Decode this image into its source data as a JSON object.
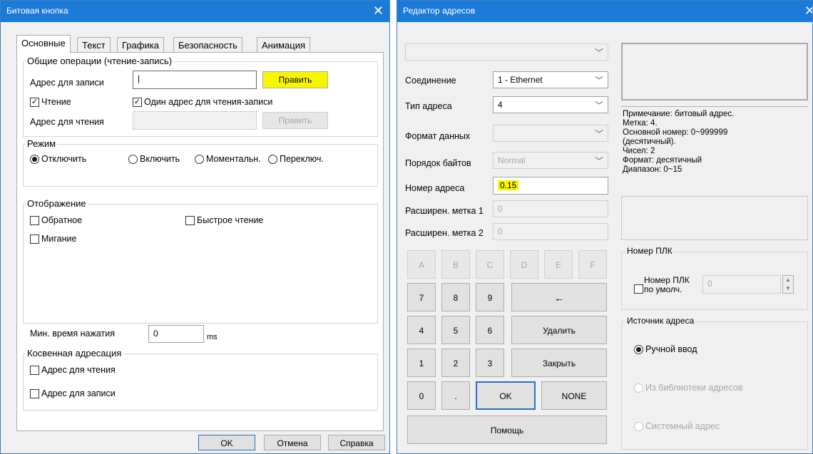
{
  "win1": {
    "title": "Битовая кнопка",
    "tabs": [
      "Основные",
      "Текст",
      "Графика",
      "Безопасность",
      "Анимация"
    ],
    "general_group": "Общие операции (чтение-запись)",
    "write_address_label": "Адрес для записи",
    "write_address_value": "|",
    "edit_button": "Править",
    "read_check_label": "Чтение",
    "single_address_label": "Один адрес для чтения-записи",
    "read_address_label": "Адрес для чтения",
    "read_address_value": "",
    "edit_button_disabled": "Править",
    "mode_group": "Режим",
    "mode_options": [
      "Отключить",
      "Включить",
      "Моментальн.",
      "Переключ."
    ],
    "display_group": "Отображение",
    "inverse_label": "Обратное",
    "fast_read_label": "Быстрое чтение",
    "blink_label": "Мигание",
    "min_press_label": "Мин. время нажатия",
    "min_press_value": "0",
    "min_press_unit": "ms",
    "indirect_group": "Косвенная адресация",
    "indirect_read_label": "Адрес для чтения",
    "indirect_write_label": "Адрес для записи",
    "ok": "OK",
    "cancel": "Отмена",
    "help": "Справка"
  },
  "win2": {
    "title": "Редактор адресов",
    "top_combo": "",
    "connection_label": "Соединение",
    "connection_value": "1 - Ethernet",
    "address_type_label": "Тип адреса",
    "address_type_value": "4",
    "data_format_label": "Формат данных",
    "data_format_value": "",
    "byte_order_label": "Порядок байтов",
    "byte_order_value": "Normal",
    "address_number_label": "Номер адреса",
    "address_number_value": "0.15",
    "ext_tag1_label": "Расширен. метка 1",
    "ext_tag1_value": "0",
    "ext_tag2_label": "Расширен. метка 2",
    "ext_tag2_value": "0",
    "hex_keys": [
      "A",
      "B",
      "C",
      "D",
      "E",
      "F"
    ],
    "digit_keys": {
      "k7": "7",
      "k8": "8",
      "k9": "9",
      "k4": "4",
      "k5": "5",
      "k6": "6",
      "k1": "1",
      "k2": "2",
      "k3": "3",
      "k0": "0",
      "kdot": "."
    },
    "backspace": "←",
    "delete": "Удалить",
    "close": "Закрыть",
    "ok": "OK",
    "none": "NONE",
    "help": "Помощь",
    "note_lines": [
      "Примечание: битовый адрес.",
      "Метка: 4.",
      "Основной номер: 0~999999",
      "(десятичный).",
      "Чисел: 2",
      "Формат: десятичный",
      "Диапазон: 0~15"
    ],
    "plc_group": "Номер ПЛК",
    "plc_default_label": "Номер ПЛК\nпо умолч.",
    "plc_value": "0",
    "source_group": "Источник адреса",
    "source_options": [
      "Ручной ввод",
      "Из библиотеки адресов",
      "Системный адрес"
    ]
  },
  "colors": {
    "titlebar": "#1c7ad8",
    "highlight": "#f6f600",
    "ok_border": "#2a6fc9"
  }
}
